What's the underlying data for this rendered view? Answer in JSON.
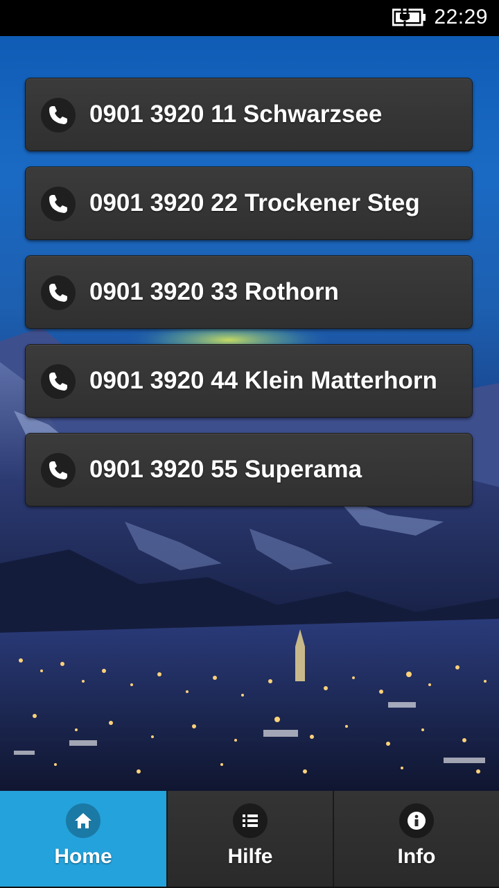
{
  "status_bar": {
    "time": "22:29",
    "battery_icon": "battery-charging-icon"
  },
  "call_list": [
    {
      "label": "0901 3920 11 Schwarzsee",
      "icon": "phone-icon"
    },
    {
      "label": "0901 3920 22 Trockener Steg",
      "icon": "phone-icon"
    },
    {
      "label": "0901 3920 33 Rothorn",
      "icon": "phone-icon"
    },
    {
      "label": "0901 3920 44 Klein Matterhorn",
      "icon": "phone-icon"
    },
    {
      "label": "0901 3920 55 Superama",
      "icon": "phone-icon"
    }
  ],
  "bottom_nav": {
    "tabs": [
      {
        "label": "Home",
        "icon": "home-icon",
        "active": true
      },
      {
        "label": "Hilfe",
        "icon": "list-icon",
        "active": false
      },
      {
        "label": "Info",
        "icon": "info-icon",
        "active": false
      }
    ]
  },
  "colors": {
    "active_tab": "#24a2dc",
    "button_bg": "#333333",
    "sky": "#1a6ac4"
  }
}
